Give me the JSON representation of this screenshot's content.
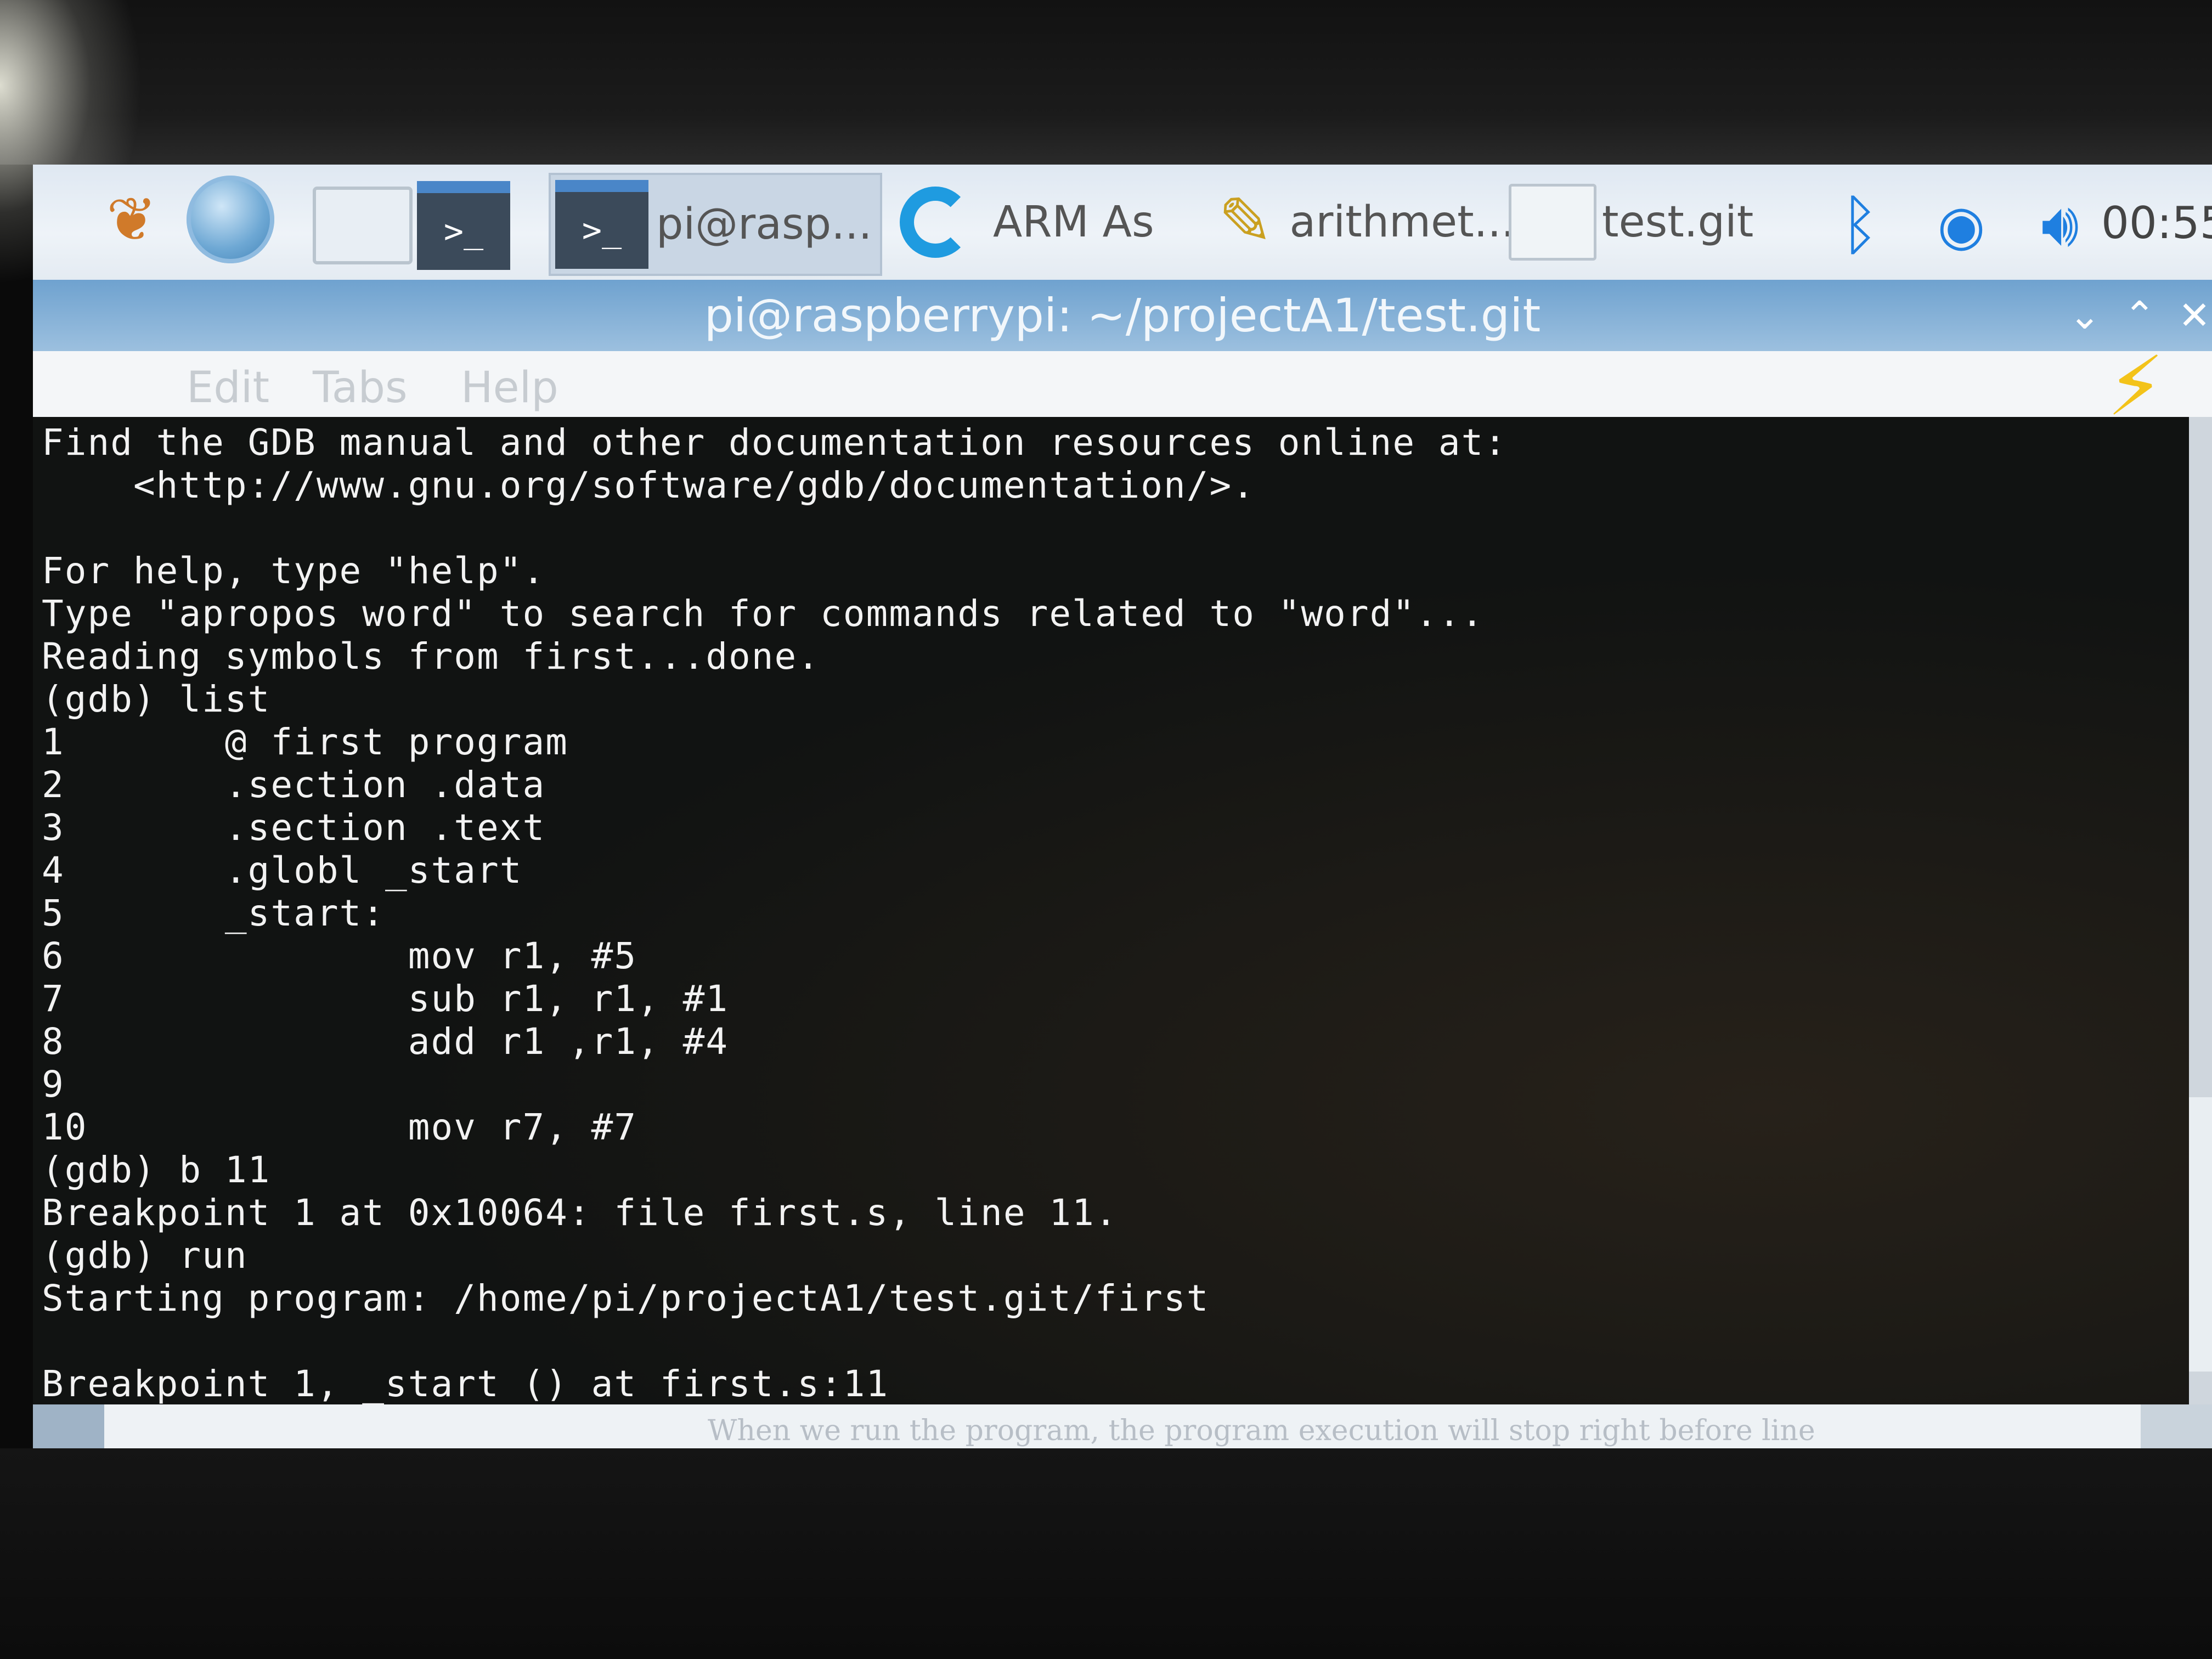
{
  "taskbar": {
    "tasks": [
      {
        "label": "pi@rasp..."
      },
      {
        "label": "ARM As"
      },
      {
        "label": "arithmet..."
      },
      {
        "label": "test.git"
      }
    ],
    "clock": "00:55"
  },
  "window": {
    "title": "pi@raspberrypi: ~/projectA1/test.git",
    "menu": [
      "Edit",
      "Tabs",
      "Help"
    ]
  },
  "terminal": {
    "lines": [
      "Find the GDB manual and other documentation resources online at:",
      "    <http://www.gnu.org/software/gdb/documentation/>.",
      "",
      "For help, type \"help\".",
      "Type \"apropos word\" to search for commands related to \"word\"...",
      "Reading symbols from first...done.",
      "(gdb) list",
      "1       @ first program",
      "2       .section .data",
      "3       .section .text",
      "4       .globl _start",
      "5       _start:",
      "6               mov r1, #5",
      "7               sub r1, r1, #1",
      "8               add r1 ,r1, #4",
      "9",
      "10              mov r7, #7",
      "(gdb) b 11",
      "Breakpoint 1 at 0x10064: file first.s, line 11.",
      "(gdb) run",
      "Starting program: /home/pi/projectA1/test.git/first",
      "",
      "Breakpoint 1, _start () at first.s:11"
    ]
  },
  "status": {
    "text": "When we run the program, the program execution will stop right before line"
  },
  "colors": {
    "taskbar": "#e4ebf2",
    "titlebar": "#7fadd6",
    "terminal_bg": "#111312",
    "terminal_fg": "#f2f2f2",
    "tray_accent": "#1f7fe0"
  },
  "icons": [
    "menu-icon",
    "globe-icon",
    "folder-icon",
    "terminal-icon",
    "terminal-icon",
    "arm-assembler-icon",
    "pencil-icon",
    "folder-icon",
    "bluetooth-icon",
    "wifi-icon",
    "volume-icon",
    "chevron-down-icon",
    "chevron-up-icon",
    "close-icon",
    "lightning-icon"
  ]
}
